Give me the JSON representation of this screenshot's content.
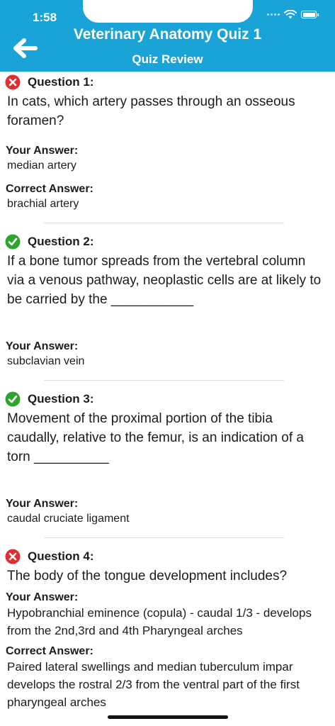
{
  "status_bar": {
    "time": "1:58"
  },
  "header": {
    "title": "Veterinary Anatomy Quiz 1",
    "subtitle": "Quiz Review"
  },
  "colors": {
    "header_bg": "#1aa3d6",
    "correct": "#2ea32e",
    "wrong": "#e02e2e"
  },
  "questions": [
    {
      "label": "Question 1:",
      "status": "wrong",
      "text": "In cats, which artery passes through an osseous foramen?",
      "your_answer_label": "Your Answer:",
      "your_answer": "median artery",
      "correct_answer_label": "Correct Answer:",
      "correct_answer": "brachial artery"
    },
    {
      "label": "Question 2:",
      "status": "correct",
      "text": "If a bone tumor spreads from the vertebral column via a venous pathway, neoplastic cells are at likely to be carried by the ___________",
      "your_answer_label": "Your Answer:",
      "your_answer": "subclavian vein"
    },
    {
      "label": "Question 3:",
      "status": "correct",
      "text": "Movement of the proximal portion of the tibia caudally, relative to the femur, is an indication of a torn __________",
      "your_answer_label": "Your Answer:",
      "your_answer": "caudal cruciate ligament"
    },
    {
      "label": "Question 4:",
      "status": "wrong",
      "text": "The body of the tongue development includes?",
      "your_answer_label": "Your Answer:",
      "your_answer": "Hypobranchial eminence (copula) - caudal 1/3 - develops from the 2nd,3rd and 4th Pharyngeal arches",
      "correct_answer_label": "Correct Answer:",
      "correct_answer": "Paired lateral swellings and median tuberculum impar develops the rostral 2/3 from the ventral part of the first pharyngeal arches"
    }
  ]
}
